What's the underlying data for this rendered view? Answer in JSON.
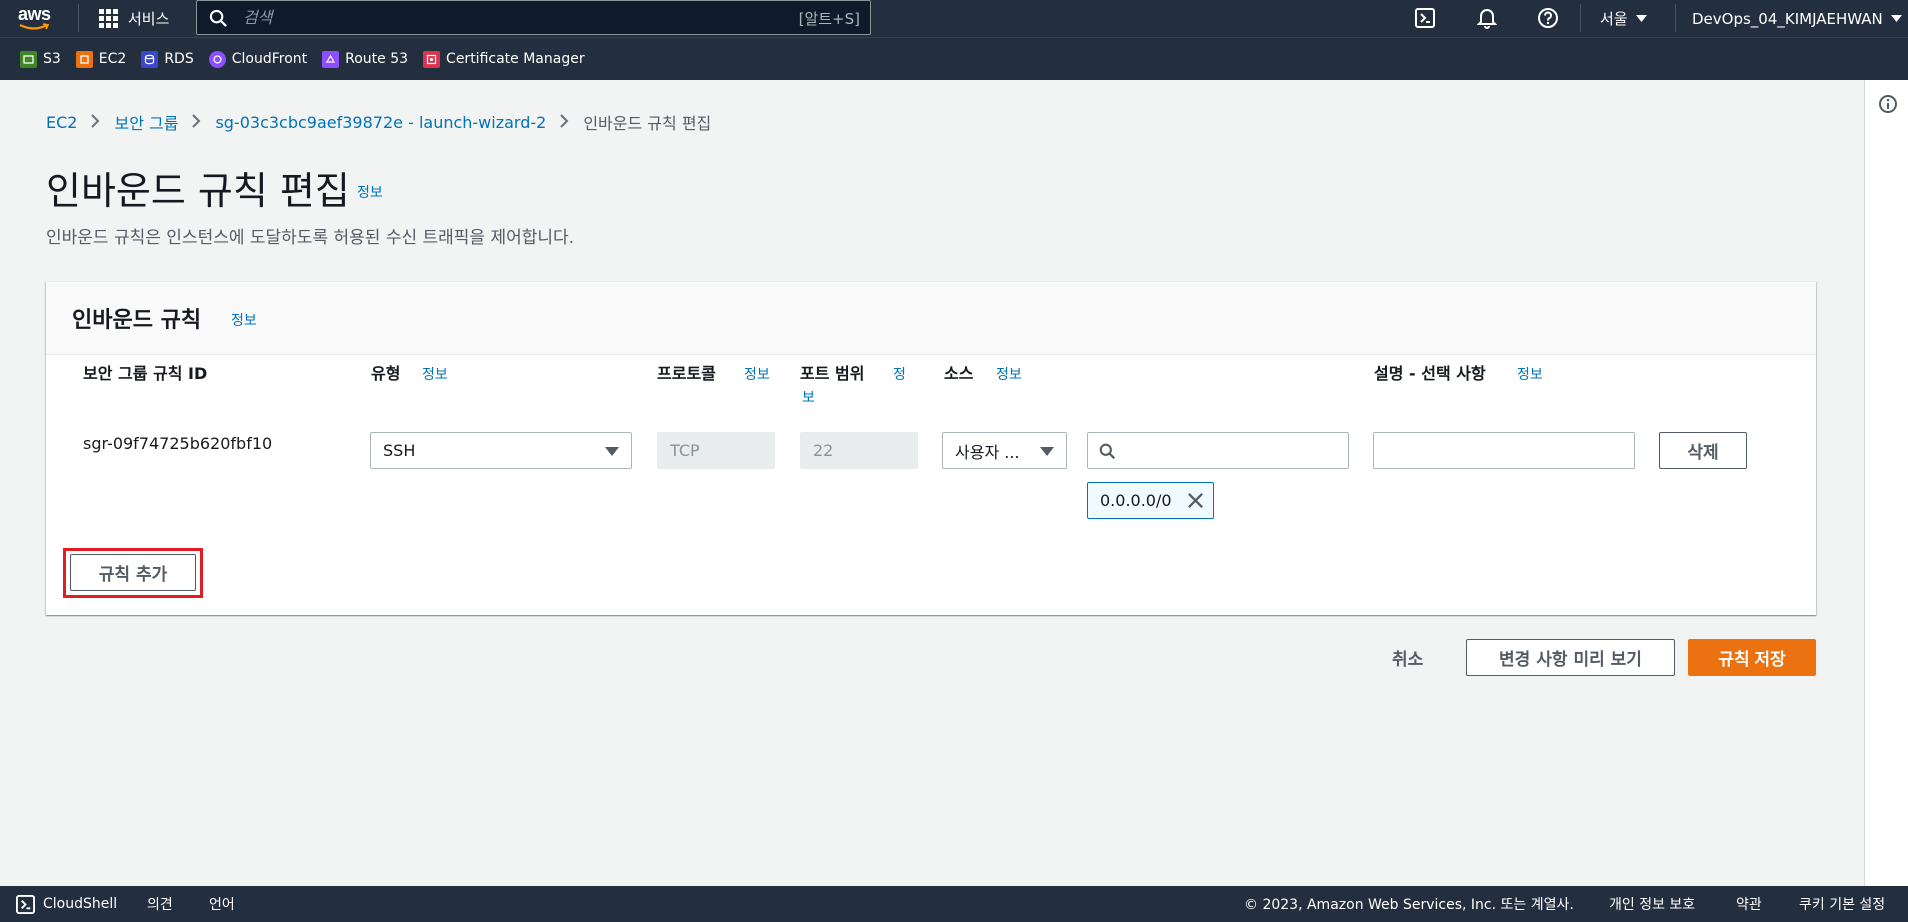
{
  "topnav": {
    "logo": "aws",
    "services_label": "서비스",
    "search_placeholder": "검색",
    "search_shortcut": "[알트+S]",
    "region": "서울",
    "account": "DevOps_04_KIMJAEHWAN",
    "icons": [
      "cloudshell-icon",
      "bell-icon",
      "help-icon"
    ]
  },
  "favorites": [
    {
      "label": "S3",
      "color": "#3f8624"
    },
    {
      "label": "EC2",
      "color": "#ec7211"
    },
    {
      "label": "RDS",
      "color": "#3b48cc"
    },
    {
      "label": "CloudFront",
      "color": "#8c4fff"
    },
    {
      "label": "Route 53",
      "color": "#8c4fff"
    },
    {
      "label": "Certificate Manager",
      "color": "#dd344c"
    }
  ],
  "breadcrumb": {
    "items": [
      "EC2",
      "보안 그룹",
      "sg-03c3cbc9aef39872e - launch-wizard-2"
    ],
    "current": "인바운드 규칙 편집"
  },
  "page": {
    "title": "인바운드 규칙 편집",
    "info": "정보",
    "description": "인바운드 규칙은 인스턴스에 도달하도록 허용된 수신 트래픽을 제어합니다."
  },
  "container": {
    "title": "인바운드 규칙",
    "info": "정보",
    "columns": {
      "rule_id": "보안 그룹 규칙 ID",
      "type": "유형",
      "protocol": "프로토콜",
      "port_range": "포트 범위",
      "port_info_1": "정",
      "port_info_2": "보",
      "source": "소스",
      "description": "설명 - 선택 사항",
      "info": "정보"
    },
    "rule": {
      "id": "sgr-09f74725b620fbf10",
      "type": "SSH",
      "protocol": "TCP",
      "port": "22",
      "source_type": "사용자 ...",
      "source_search": "",
      "cidr_token": "0.0.0.0/0",
      "description": "",
      "delete_label": "삭제"
    },
    "add_rule_label": "규칙 추가"
  },
  "actions": {
    "cancel": "취소",
    "preview": "변경 사항 미리 보기",
    "save": "규칙 저장"
  },
  "footer": {
    "cloudshell": "CloudShell",
    "feedback": "의견",
    "language": "언어",
    "copyright": "© 2023, Amazon Web Services, Inc. 또는 계열사.",
    "privacy": "개인 정보 보호",
    "terms": "약관",
    "cookies": "쿠키 기본 설정"
  },
  "colors": {
    "nav_bg": "#232f3e",
    "link": "#0073bb",
    "primary": "#ec7211",
    "highlight": "#e31b23"
  }
}
